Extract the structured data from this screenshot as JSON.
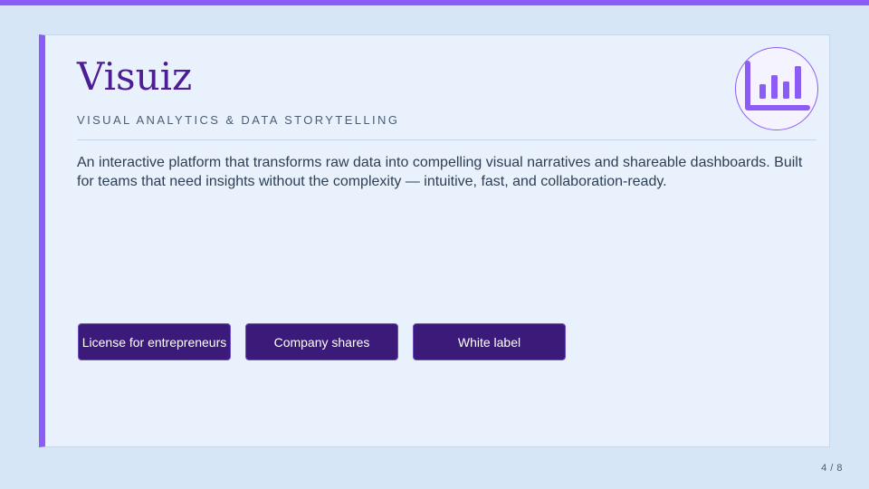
{
  "slide": {
    "title": "Visuiz",
    "subtitle": "VISUAL ANALYTICS & DATA STORYTELLING",
    "description": "An interactive platform that transforms raw data into compelling visual narratives and shareable dashboards. Built for teams that need insights without the complexity — intuitive, fast, and collaboration-ready.",
    "logo_icon": "bar-chart-icon",
    "buttons": [
      {
        "label": "License for entrepreneurs"
      },
      {
        "label": "Company shares"
      },
      {
        "label": "White label"
      }
    ]
  },
  "pagination": {
    "text": "4 / 8"
  },
  "colors": {
    "accent": "#8b5cf6",
    "title": "#4c1d95",
    "button": "#3b1a7a",
    "background": "#d6e6f7",
    "card": "#e8f1fc"
  }
}
